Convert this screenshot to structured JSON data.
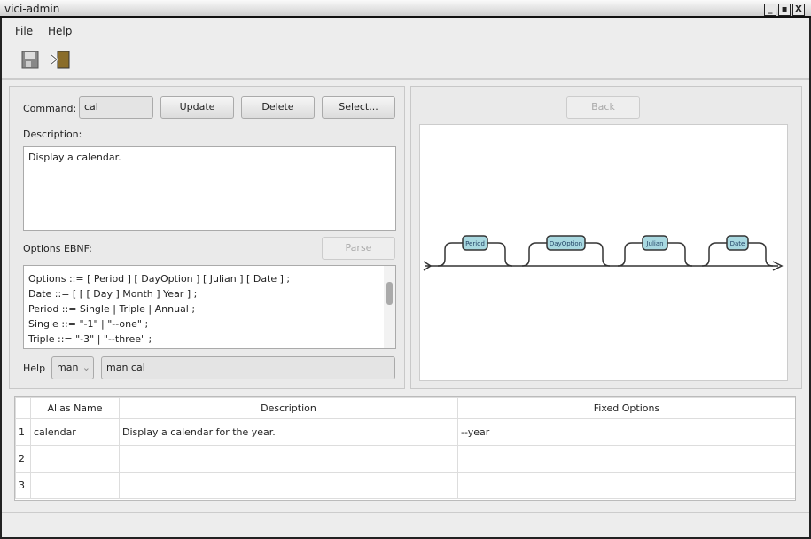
{
  "window": {
    "title": "vici-admin",
    "controls": [
      "_",
      "▪",
      "X"
    ]
  },
  "menu": [
    {
      "label": "File"
    },
    {
      "label": "Help"
    }
  ],
  "toolbar": {
    "icons": [
      "save-icon",
      "exit-icon"
    ]
  },
  "left": {
    "command_label": "Command:",
    "command_value": "cal",
    "update": "Update",
    "delete": "Delete",
    "select": "Select...",
    "description_label": "Description:",
    "description_value": "Display a calendar.",
    "options_label": "Options EBNF:",
    "parse": "Parse",
    "ebnf_lines": [
      "Options ::= [ Period ] [ DayOption ] [ Julian ] [ Date ] ;",
      "Date ::= [ [ [ Day ] Month ] Year ] ;",
      "Period ::= Single | Triple | Annual ;",
      "Single ::= \"-1\" | \"--one\" ;",
      "Triple ::= \"-3\" | \"--three\" ;"
    ],
    "help_label": "Help",
    "help_select": "man",
    "help_value": "man cal"
  },
  "right": {
    "back": "Back",
    "diagram": {
      "items": [
        "Period",
        "DayOption",
        "Julian",
        "Date"
      ],
      "box_color": "#a8d8e0"
    }
  },
  "table": {
    "headers": [
      "",
      "Alias Name",
      "Description",
      "Fixed Options"
    ],
    "rows": [
      [
        "1",
        "calendar",
        "Display a calendar for the year.",
        "--year"
      ],
      [
        "2",
        "",
        "",
        ""
      ],
      [
        "3",
        "",
        "",
        ""
      ]
    ]
  }
}
